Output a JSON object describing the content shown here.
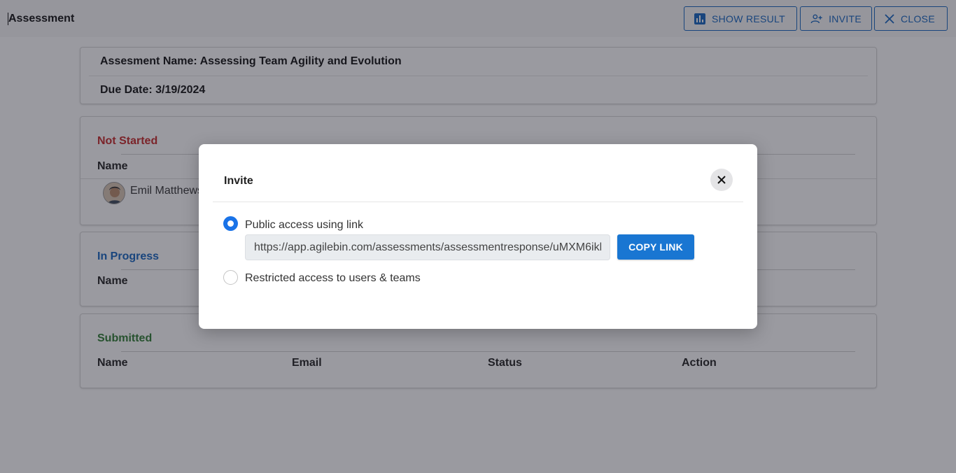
{
  "header": {
    "title": "Assessment",
    "buttons": {
      "show_result": "SHOW RESULT",
      "invite": "INVITE",
      "close": "CLOSE"
    }
  },
  "assessment": {
    "name_line": "Assesment Name: Assessing Team Agility and Evolution",
    "due_line": "Due Date: 3/19/2024"
  },
  "sections": {
    "not_started": {
      "title": "Not Started",
      "col_name": "Name",
      "rows": [
        {
          "name": "Emil Matthews"
        }
      ]
    },
    "in_progress": {
      "title": "In Progress",
      "col_name": "Name"
    },
    "submitted": {
      "title": "Submitted",
      "columns": [
        "Name",
        "Email",
        "Status",
        "Action"
      ]
    }
  },
  "modal": {
    "title": "Invite",
    "options": {
      "public": "Public access using link",
      "restricted": "Restricted access to users & teams"
    },
    "selected": "public",
    "link_value": "https://app.agilebin.com/assessments/assessmentresponse/uMXM6ikl",
    "copy_label": "COPY LINK"
  },
  "colors": {
    "primary": "#1976d2",
    "not_started": "#c62828",
    "in_progress": "#1565c0",
    "submitted": "#2e7d32",
    "overlay": "rgba(30,30,45,0.45)"
  },
  "icons": {
    "show_result": "bar-chart-icon",
    "invite": "person-add-icon",
    "close": "close-icon",
    "modal_close": "close-icon"
  }
}
